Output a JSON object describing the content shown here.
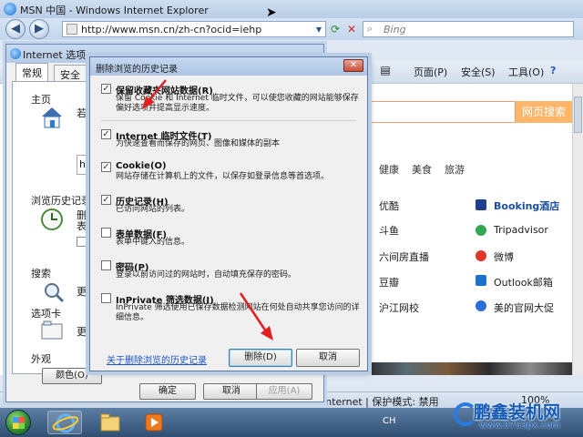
{
  "ie": {
    "title": "MSN 中国 - Windows Internet Explorer",
    "url": "http://www.msn.cn/zh-cn?ocid=iehp",
    "search_placeholder": "Bing",
    "cmd": {
      "page": "页面(P)",
      "safety": "安全(S)",
      "tools": "工具(O)",
      "help": "?"
    },
    "page_search_button": "网页搜索",
    "categories": [
      "健康",
      "美食",
      "旅游"
    ],
    "sites": {
      "c1": [
        "优酷",
        "斗鱼",
        "六间房直播",
        "豆瓣",
        "沪江网校"
      ],
      "c2": [
        "Booking酒店",
        "Tripadvisor",
        "微博",
        "Outlook邮箱",
        "美的官网大促"
      ]
    },
    "status_zone": "Internet | 保护模式: 禁用",
    "zoom": "100%"
  },
  "options": {
    "title": "Internet 选项",
    "tabs": [
      "常规",
      "安全"
    ],
    "home_label": "主页",
    "home_text": "若要创",
    "home_input": "http",
    "history_label": "浏览历史记录",
    "history_text": "删除",
    "history_text2": "表单",
    "history_cb": "退",
    "search_label": "搜索",
    "search_text": "更改搜",
    "tabs_label": "选项卡",
    "tabs_text": "更改网",
    "appearance_label": "外观",
    "color_button": "颜色(O)",
    "ok": "确定",
    "cancel": "取消",
    "apply": "应用(A)"
  },
  "dbh": {
    "title": "删除浏览的历史记录",
    "items": [
      {
        "label": "保留收藏夹网站数据(R)",
        "desc": "保留 Cookie 和 Internet 临时文件，可以使您收藏的网站能够保存偏好选项并提高显示速度。",
        "checked": "✓"
      },
      {
        "label": "Internet 临时文件(T)",
        "desc": "为快速查看而保存的网页、图像和媒体的副本",
        "checked": "✓"
      },
      {
        "label": "Cookie(O)",
        "desc": "网站存储在计算机上的文件，以保存如登录信息等首选项。",
        "checked": "✓"
      },
      {
        "label": "历史记录(H)",
        "desc": "已访问网站的列表。",
        "checked": "✓"
      },
      {
        "label": "表单数据(F)",
        "desc": "表单中键入的信息。",
        "checked": ""
      },
      {
        "label": "密码(P)",
        "desc": "登录以前访问过的网站时，自动填充保存的密码。",
        "checked": ""
      },
      {
        "label": "InPrivate 筛选数据(I)",
        "desc": "InPrivate 筛选使用已保存数据检测网站在何处自动共享您访问的详细信息。",
        "checked": ""
      }
    ],
    "link": "关于删除浏览的历史记录",
    "delete": "删除(D)",
    "cancel": "取消"
  },
  "taskbar": {
    "tray": "CH"
  },
  "watermark": {
    "line1": "鹏鑫装机网",
    "line2": "www.0753px.com"
  },
  "colors": {
    "accent": "#ffb56a",
    "arrow": "#e02020",
    "title_blue": "#b6cbe5"
  }
}
